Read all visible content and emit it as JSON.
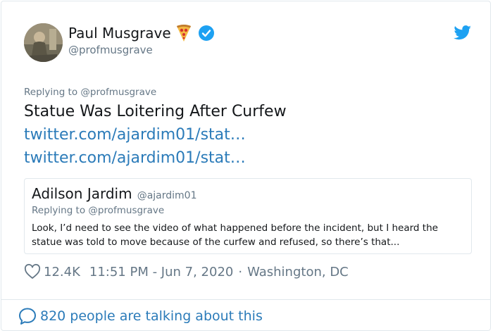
{
  "author": {
    "name": "Paul Musgrave",
    "handle": "@profmusgrave",
    "emoji_icon": "pizza-icon",
    "verified_icon": "verified-badge-icon"
  },
  "header": {
    "brand_icon": "twitter-bird-icon"
  },
  "tweet": {
    "replying_to": "Replying to @profmusgrave",
    "text": "Statue Was Loitering After Curfew",
    "links": [
      "twitter.com/ajardim01/stat…",
      "twitter.com/ajardim01/stat…"
    ]
  },
  "quoted_tweet": {
    "name": "Adilson Jardim",
    "handle": "@ajardim01",
    "replying_to": "Replying to @profmusgrave",
    "text": "Look, I’d need to see the video of what happened before the incident, but I heard the statue was told to move because of the curfew and refused, so there’s that..."
  },
  "meta": {
    "likes": "12.4K",
    "timestamp": "11:51 PM - Jun 7, 2020",
    "separator": "·",
    "location": "Washington, DC"
  },
  "footer": {
    "talking": "820 people are talking about this"
  },
  "colors": {
    "link": "#2b7bb9",
    "muted": "#657786",
    "verified": "#1da1f2",
    "border": "#e1e8ed"
  }
}
